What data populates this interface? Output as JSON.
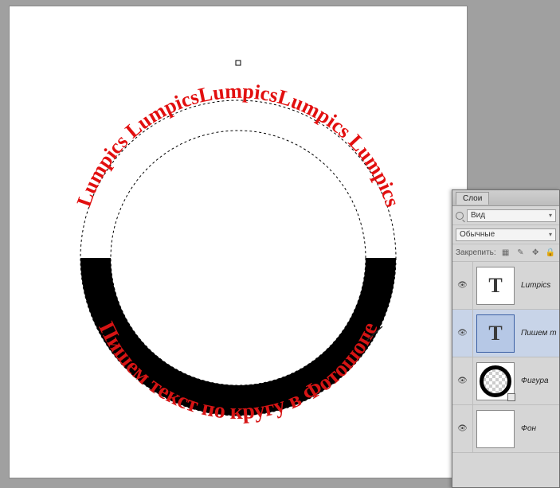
{
  "panel": {
    "title": "Слои",
    "search_mode": "Вид",
    "blend_mode": "Обычные",
    "lock_label": "Закрепить:"
  },
  "layers": [
    {
      "name": "Lumpics",
      "type": "text",
      "visible": true,
      "selected": false
    },
    {
      "name": "Пишем т",
      "type": "text",
      "visible": true,
      "selected": true
    },
    {
      "name": "Фигура",
      "type": "shape",
      "visible": true,
      "selected": false
    },
    {
      "name": "Фон",
      "type": "bg",
      "visible": true,
      "selected": false
    }
  ],
  "canvas": {
    "top_text": "Lumpics LumpicsLumpicsLumpics Lumpics",
    "bottom_text": "Пишем текст по кругу в Фотошопе"
  }
}
